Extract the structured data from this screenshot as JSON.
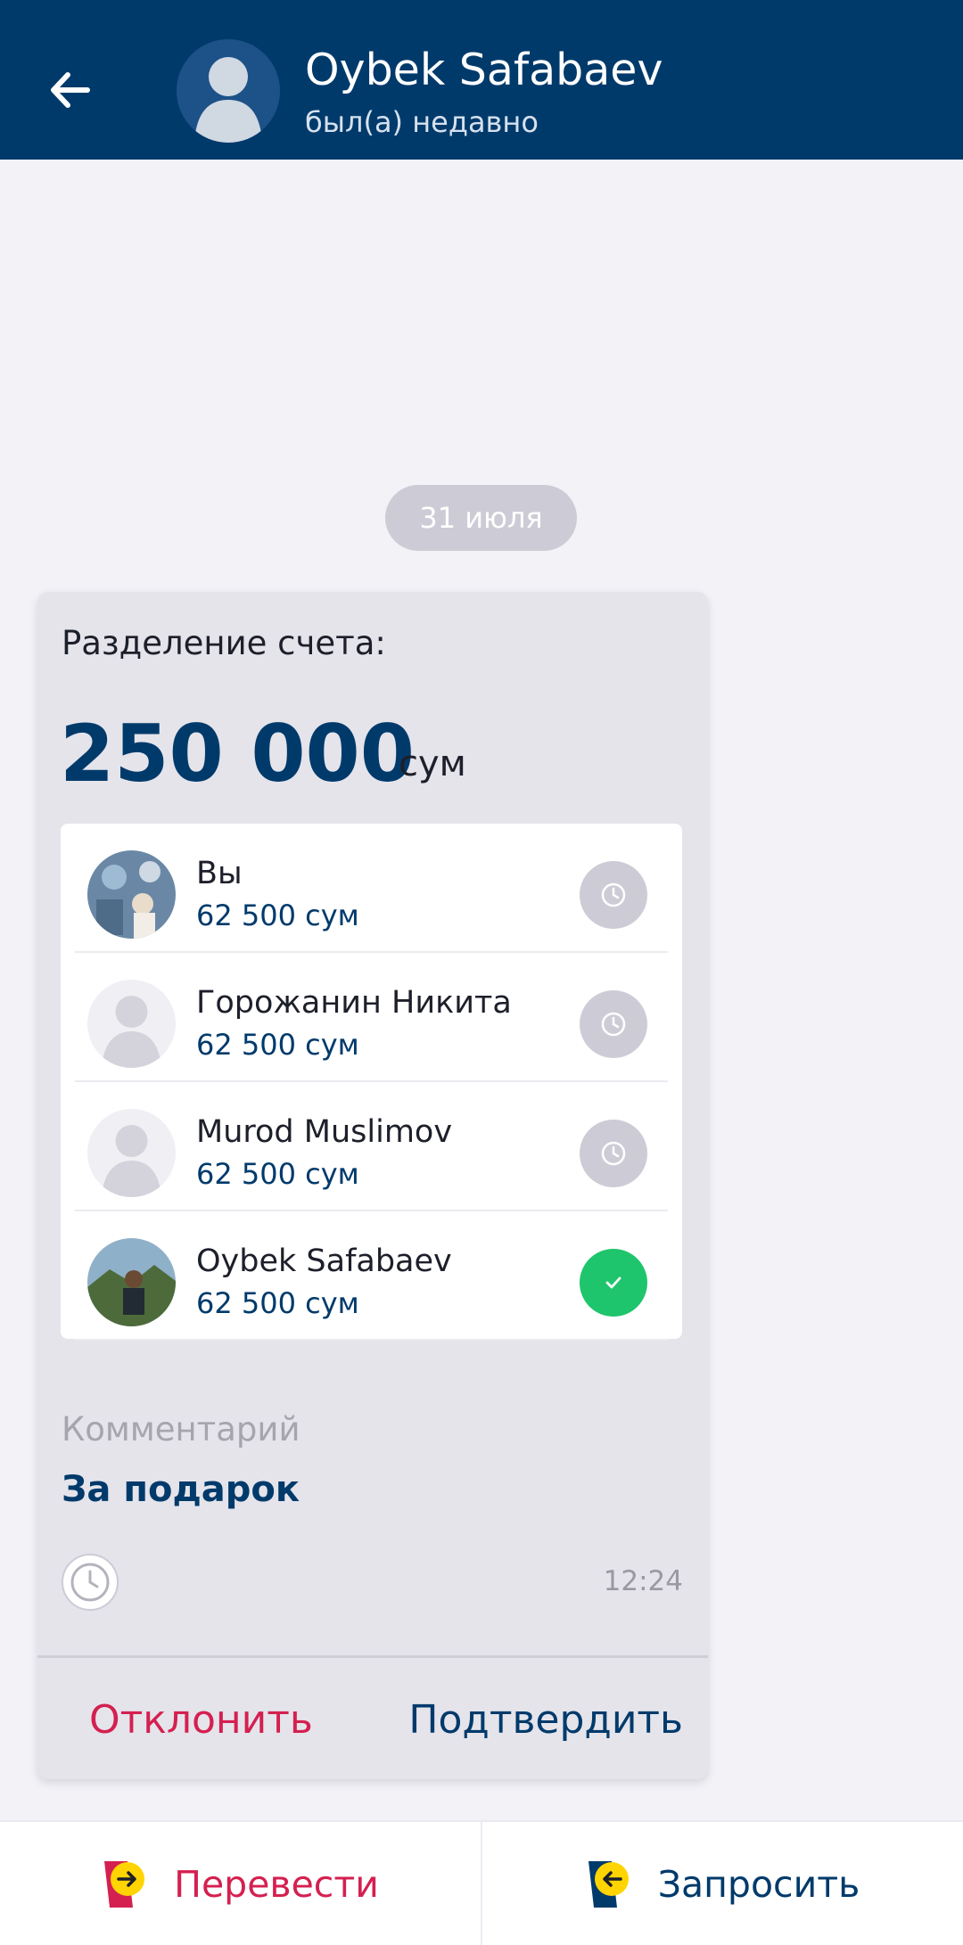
{
  "header": {
    "name": "Oybek Safabaev",
    "status": "был(а) недавно"
  },
  "date_divider": "31 июля",
  "split_card": {
    "title": "Разделение счета:",
    "amount": "250 000",
    "currency": "сум",
    "participants": [
      {
        "name": "Вы",
        "amount": "62 500 сум",
        "status": "pending",
        "avatar": "photo"
      },
      {
        "name": "Горожанин Никита",
        "amount": "62 500 сум",
        "status": "pending",
        "avatar": "placeholder"
      },
      {
        "name": "Murod Muslimov",
        "amount": "62 500 сум",
        "status": "pending",
        "avatar": "placeholder"
      },
      {
        "name": "Oybek Safabaev",
        "amount": "62 500 сум",
        "status": "confirmed",
        "avatar": "photo"
      }
    ],
    "comment_label": "Комментарий",
    "comment_value": "За подарок",
    "time": "12:24",
    "reject_label": "Отклонить",
    "confirm_label": "Подтвердить"
  },
  "bottom_bar": {
    "transfer_label": "Перевести",
    "request_label": "Запросить"
  },
  "colors": {
    "brand_blue": "#003a6b",
    "accent_red": "#d42050",
    "success_green": "#1ec56c",
    "pending_gray": "#cdccd6"
  }
}
